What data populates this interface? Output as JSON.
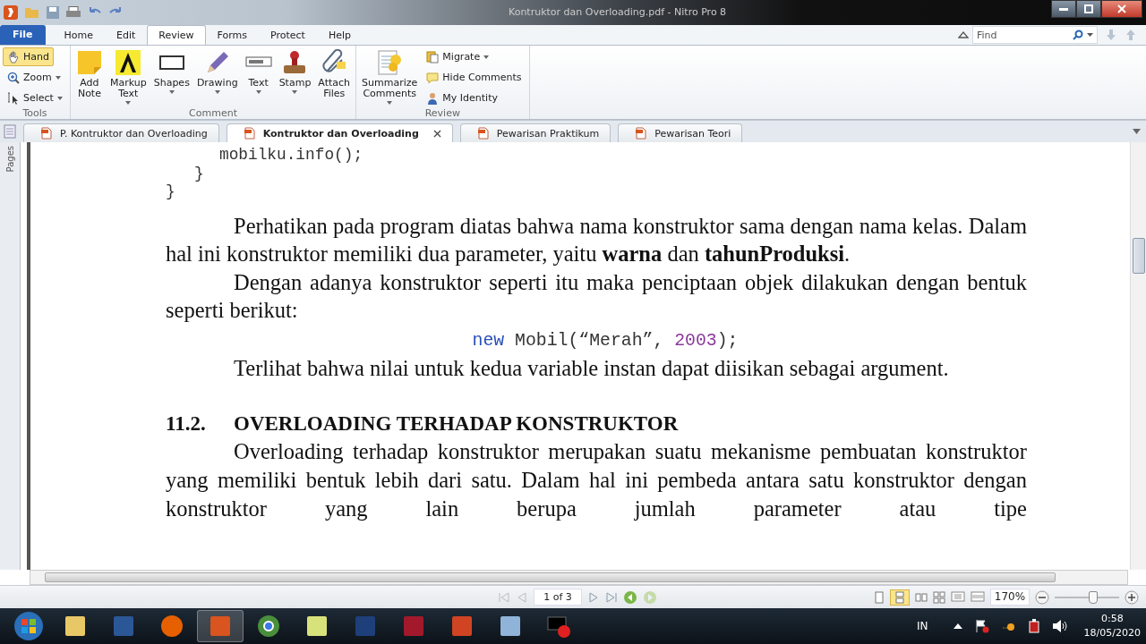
{
  "window": {
    "title": "Kontruktor dan Overloading.pdf - Nitro Pro 8"
  },
  "ribbon_tabs": [
    {
      "label": "File",
      "kind": "file",
      "selected": false
    },
    {
      "label": "Home",
      "kind": "tab",
      "selected": false
    },
    {
      "label": "Edit",
      "kind": "tab",
      "selected": false
    },
    {
      "label": "Review",
      "kind": "tab",
      "selected": true
    },
    {
      "label": "Forms",
      "kind": "tab",
      "selected": false
    },
    {
      "label": "Protect",
      "kind": "tab",
      "selected": false
    },
    {
      "label": "Help",
      "kind": "tab",
      "selected": false
    }
  ],
  "find": {
    "placeholder": "Find"
  },
  "tools_group": {
    "label": "Tools",
    "items": [
      {
        "label": "Hand",
        "dropdown": false,
        "selected": true
      },
      {
        "label": "Zoom",
        "dropdown": true,
        "selected": false
      },
      {
        "label": "Select",
        "dropdown": true,
        "selected": false
      }
    ]
  },
  "comment_group": {
    "label": "Comment",
    "items": [
      {
        "lines": [
          "Add",
          "Note"
        ],
        "dropdown": false
      },
      {
        "lines": [
          "Markup",
          "Text"
        ],
        "dropdown": true
      },
      {
        "lines": [
          "Shapes"
        ],
        "dropdown": true
      },
      {
        "lines": [
          "Drawing"
        ],
        "dropdown": true
      },
      {
        "lines": [
          "Text"
        ],
        "dropdown": true
      },
      {
        "lines": [
          "Stamp"
        ],
        "dropdown": true
      },
      {
        "lines": [
          "Attach",
          "Files"
        ],
        "dropdown": false
      }
    ]
  },
  "review_group": {
    "label": "Review",
    "large": {
      "lines": [
        "Summarize",
        "Comments"
      ],
      "dropdown": true
    },
    "items": [
      {
        "label": "Migrate",
        "dropdown": true
      },
      {
        "label": "Hide Comments",
        "dropdown": false
      },
      {
        "label": "My Identity",
        "dropdown": false
      }
    ]
  },
  "doc_tabs": [
    {
      "label": "P. Kontruktor dan Overloading",
      "selected": false
    },
    {
      "label": "Kontruktor dan Overloading",
      "selected": true
    },
    {
      "label": "Pewarisan Praktikum",
      "selected": false
    },
    {
      "label": "Pewarisan Teori",
      "selected": false
    }
  ],
  "side_panel": {
    "label": "Pages"
  },
  "document": [
    {
      "kind": "code",
      "text": "}",
      "children": [
        {
          "text": "}",
          "children": [
            {
              "text": "mobilku.info();"
            }
          ]
        }
      ]
    },
    {
      "kind": "paragraph",
      "text": "Perhatikan pada program diatas bahwa nama konstruktor sama dengan nama kelas. Dalam hal ini konstruktor memiliki dua parameter, yaitu **warna** dan **tahunProduksi**.",
      "continues": false
    },
    {
      "kind": "paragraph",
      "text": "Dengan adanya konstruktor seperti itu maka penciptaan objek dilakukan dengan bentuk seperti berikut:",
      "continues": false
    },
    {
      "kind": "code_center",
      "tokens": [
        {
          "kind": "keyword",
          "text": "new"
        },
        {
          "kind": "plain",
          "text": " Mobil(“Merah”, "
        },
        {
          "kind": "number",
          "text": "2003"
        },
        {
          "kind": "plain",
          "text": ");"
        }
      ]
    },
    {
      "kind": "paragraph",
      "text": "Terlihat bahwa nilai untuk kedua variable instan dapat diisikan sebagai argument.",
      "continues": false
    },
    {
      "kind": "heading",
      "number": "11.2.",
      "text": "OVERLOADING TERHADAP KONSTRUKTOR"
    },
    {
      "kind": "paragraph",
      "text": "Overloading terhadap konstruktor merupakan suatu mekanisme pembuatan konstruktor yang memiliki bentuk lebih dari satu. Dalam hal ini pembeda antara satu konstruktor dengan konstruktor yang lain berupa jumlah parameter atau tipe",
      "continues": true
    }
  ],
  "status_bar": {
    "page": "1 of 3",
    "zoom": "170%",
    "zoom_slider": {
      "level": 0.6
    }
  },
  "taskbar": {
    "apps": [
      {
        "active": false
      },
      {
        "active": false
      },
      {
        "active": false
      },
      {
        "active": true
      },
      {
        "active": false
      },
      {
        "active": false
      },
      {
        "active": false
      },
      {
        "active": false
      },
      {
        "active": false
      },
      {
        "active": false
      },
      {
        "active": false
      }
    ],
    "language": "IN",
    "time": "0:58",
    "date": "18/05/2020"
  }
}
